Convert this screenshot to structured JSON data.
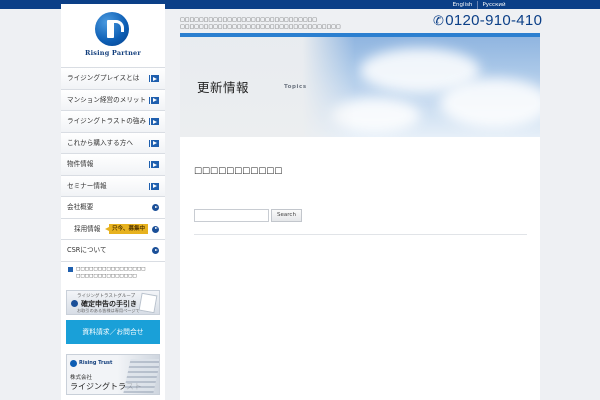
{
  "header": {
    "lang_links": [
      "English",
      "Русский"
    ],
    "tagline_line1": "□□□□□□□□□□□□□□□□□□□□□□□□□□□□□",
    "tagline_line2": "□□□□□□□□□□□□□□□□□□□□□□□□□□□□□□□□□□",
    "phone": "0120-910-410",
    "phone_icon": "phone-icon"
  },
  "sidebar": {
    "logo_text": "Rising Partner",
    "nav_primary": [
      "ライジングプレイスとは",
      "マンション経営のメリット",
      "ライジングトラストの強み",
      "これから購入する方へ",
      "物件情報",
      "セミナー情報"
    ],
    "nav_secondary": [
      {
        "label": "会社概要"
      },
      {
        "label": "採用情報",
        "badge": "只今、募集中"
      },
      {
        "label": "CSRについて"
      }
    ],
    "note_line1": "□□□□□□□□□□□□□□□□",
    "note_line2": "□□□□□□□□□□□□□□",
    "tax_banner": {
      "line1": "ライジングトラストグループ",
      "line2": "確定申告の手引き",
      "line3": "お取引のある皆様は専用ページで"
    },
    "request_button": "資料請求／お問合せ",
    "trust_banner": {
      "en": "Rising Trust",
      "company": "株式会社",
      "name": "ライジングトラスト"
    }
  },
  "main": {
    "hero_title": "更新情報",
    "hero_subtitle": "Topics",
    "section_title": "□□□□□□□□□□□",
    "search_placeholder": "",
    "search_button": "Search"
  },
  "colors": {
    "brand_blue": "#0b3f87",
    "accent_blue": "#1aa0d8",
    "badge_yellow": "#e7b21f"
  }
}
